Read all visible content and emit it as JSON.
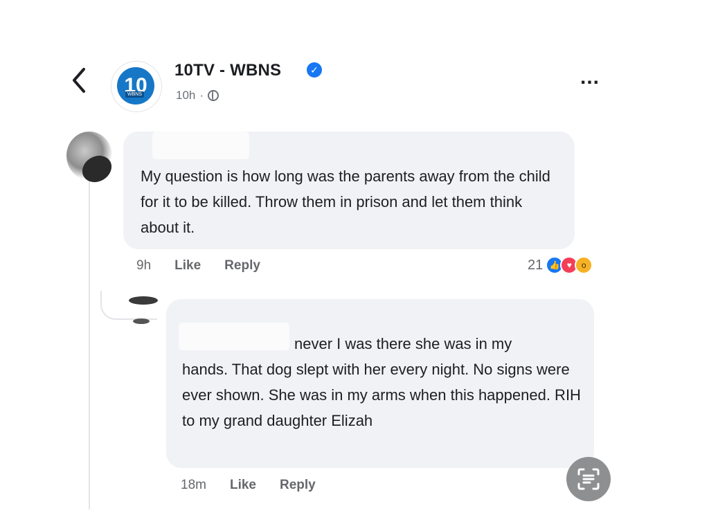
{
  "header": {
    "back_icon": "chevron-left-icon",
    "page_name": "10TV - WBNS",
    "avatar_text": "10",
    "avatar_sub": "WBNS",
    "time": "10h",
    "separator": "·",
    "privacy_icon": "globe-icon",
    "more_icon": "more-horizontal-icon",
    "more_text": "..."
  },
  "comments": [
    {
      "text": "My question is how long was the parents away from the child for it to be killed. Throw them in prison and let them think about it.",
      "time": "9h",
      "like_label": "Like",
      "reply_label": "Reply",
      "reaction_count": "21",
      "reactions": [
        "like",
        "love",
        "wow"
      ]
    },
    {
      "text_first_line": "never I was there she was in my",
      "text": "hands. That dog slept with her every night. No signs were ever shown. She was in my arms when this happened. RIH to my grand daughter Elizah",
      "time": "18m",
      "like_label": "Like",
      "reply_label": "Reply"
    }
  ],
  "colors": {
    "accent": "#1877f2",
    "bubble": "#f0f2f5",
    "meta_text": "#65676b"
  }
}
